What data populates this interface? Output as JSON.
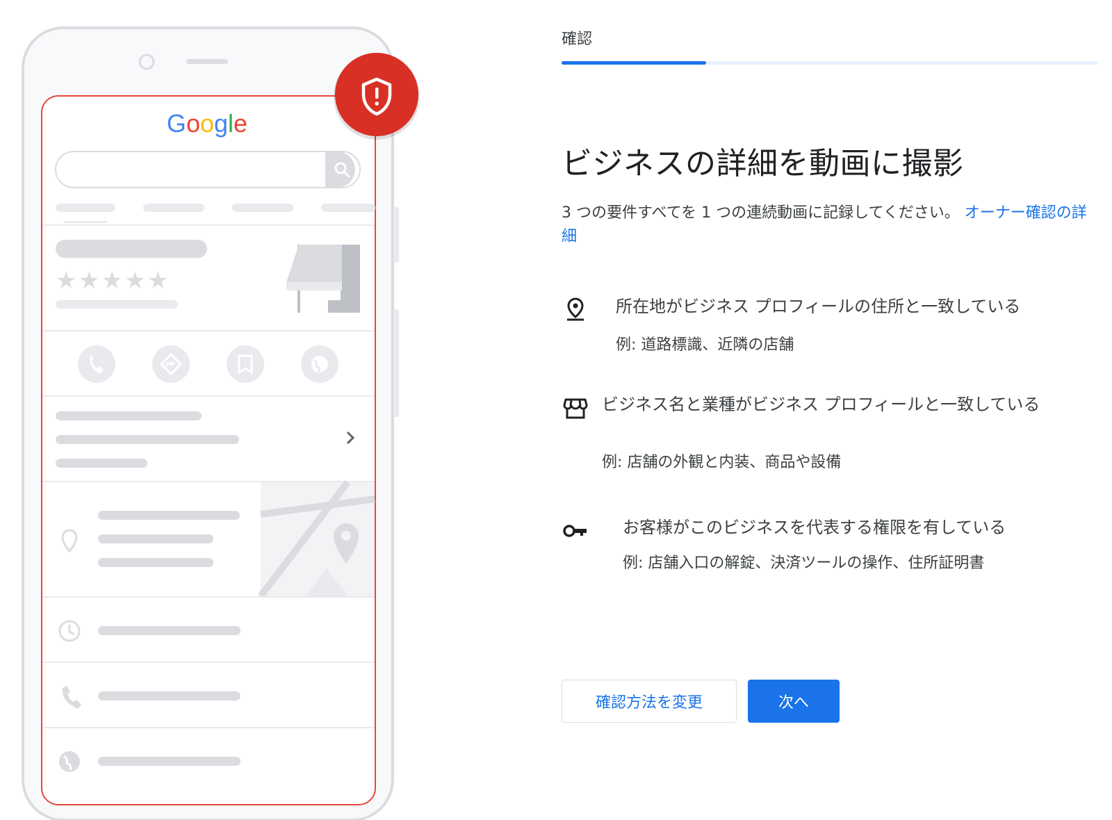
{
  "brand": {
    "logo_text": "Google",
    "colors": {
      "blue": "#4285F4",
      "red": "#EA4335",
      "yellow": "#FBBC05",
      "green": "#34A853",
      "accent": "#1a73e8",
      "alert": "#d93025"
    }
  },
  "illustration": {
    "badge_icon": "shield-alert-icon",
    "rating_stars": 5,
    "action_icons": [
      "phone-icon",
      "directions-icon",
      "bookmark-icon",
      "globe-icon"
    ],
    "detail_icons": [
      "pin-icon",
      "clock-icon",
      "phone-icon",
      "globe-icon"
    ]
  },
  "header": {
    "step_label": "確認",
    "progress_fraction": 0.27
  },
  "main": {
    "title": "ビジネスの詳細を動画に撮影",
    "intro_text": "3 つの要件すべてを 1 つの連続動画に記録してください。",
    "intro_link": "オーナー確認の詳細"
  },
  "requirements": [
    {
      "icon": "location-pin-icon",
      "text": "所在地がビジネス プロフィールの住所と一致している",
      "example": "例: 道路標識、近隣の店舗"
    },
    {
      "icon": "storefront-icon",
      "text": "ビジネス名と業種がビジネス プロフィールと一致している",
      "example": "例: 店舗の外観と内装、商品や設備"
    },
    {
      "icon": "key-icon",
      "text": "お客様がこのビジネスを代表する権限を有している",
      "example": "例: 店舗入口の解錠、決済ツールの操作、住所証明書"
    }
  ],
  "buttons": {
    "change_method": "確認方法を変更",
    "next": "次へ"
  }
}
